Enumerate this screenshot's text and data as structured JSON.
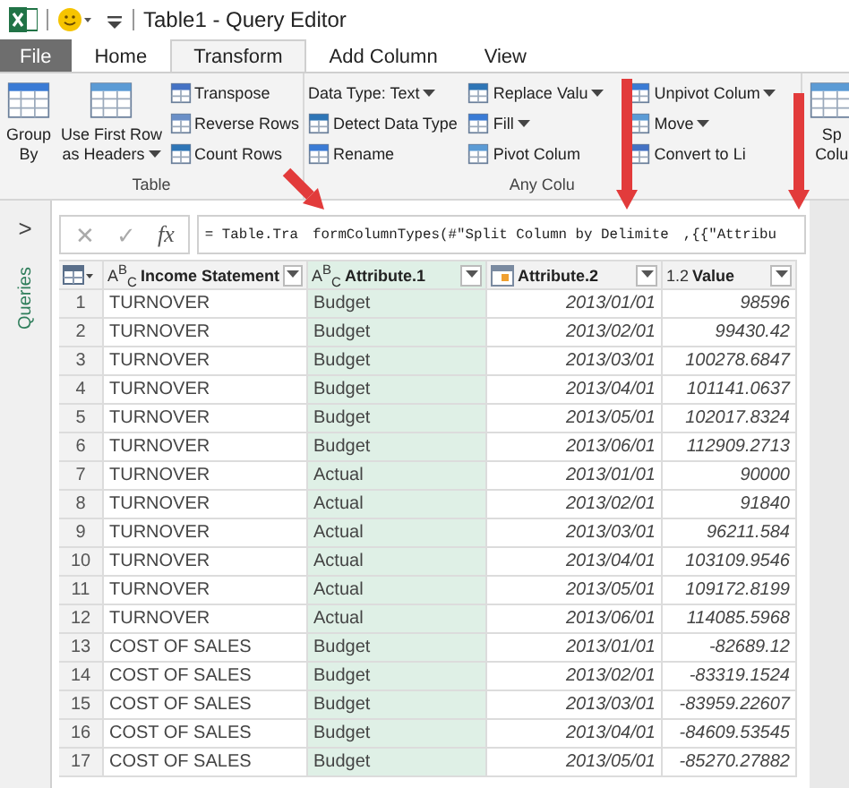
{
  "window": {
    "title": "Table1 - Query Editor"
  },
  "tabs": [
    {
      "label": "File",
      "kind": "file",
      "selected": false
    },
    {
      "label": "Home",
      "kind": "tab",
      "selected": false
    },
    {
      "label": "Transform",
      "kind": "tab",
      "selected": true
    },
    {
      "label": "Add Column",
      "kind": "tab",
      "selected": false
    },
    {
      "label": "View",
      "kind": "tab",
      "selected": false
    }
  ],
  "ribbon": {
    "groups": [
      {
        "label": "Table",
        "columns": [
          [
            {
              "kind": "large",
              "lines": [
                "Group",
                "By"
              ],
              "dropdown": false
            }
          ],
          [
            {
              "kind": "large",
              "lines": [
                "Use First Row",
                "as Headers"
              ],
              "dropdown": true
            }
          ],
          [
            {
              "kind": "small",
              "label": "Transpose",
              "dropdown": false
            },
            {
              "kind": "small",
              "label": "Reverse Rows",
              "dropdown": false
            },
            {
              "kind": "small",
              "label": "Count Rows",
              "dropdown": false
            }
          ]
        ]
      },
      {
        "label": "Any Colu",
        "columns": [
          [
            {
              "kind": "text",
              "label": "Data Type: Text",
              "dropdown": true
            },
            {
              "kind": "small",
              "label": "Detect Data Type",
              "dropdown": false
            },
            {
              "kind": "small",
              "label": "Rename",
              "dropdown": false
            }
          ],
          [
            {
              "kind": "small",
              "label": "Replace Valu",
              "dropdown": true
            },
            {
              "kind": "small",
              "label": "Fill",
              "dropdown": true
            },
            {
              "kind": "small",
              "label": "Pivot Colum",
              "dropdown": false
            }
          ],
          [
            {
              "kind": "small",
              "label": "Unpivot Colum",
              "dropdown": true
            },
            {
              "kind": "small",
              "label": "Move",
              "dropdown": true
            },
            {
              "kind": "small",
              "label": "Convert to Li",
              "dropdown": false
            }
          ]
        ]
      },
      {
        "columns": [
          [
            {
              "kind": "large",
              "lines": [
                "Sp",
                "Colu"
              ],
              "dropdown": false
            }
          ]
        ]
      }
    ]
  },
  "sidebar": {
    "expand": ">",
    "label": "Queries"
  },
  "formula_bar": {
    "cancel": "✕",
    "commit": "✓",
    "fx": "fx",
    "segments": [
      "= Table.Tra",
      "formColumnTypes(#\"Split Column by Delimite",
      ",{{\"Attribu"
    ]
  },
  "table": {
    "columns": [
      {
        "label": "Income Statement",
        "kind": "text",
        "type_label": "A$^{B}$$_{C}$",
        "selected": false
      },
      {
        "label": "Attribute.1",
        "kind": "text",
        "type_label": "A$^{B}$$_{C}$",
        "selected": true
      },
      {
        "label": "Attribute.2",
        "kind": "date",
        "selected": false
      },
      {
        "label": "Value",
        "kind": "number",
        "type_label": "1.2",
        "selected": false
      }
    ],
    "rows": [
      {
        "number": "1",
        "cells": [
          "TURNOVER",
          "Budget",
          "2013/01/01",
          "98596"
        ]
      },
      {
        "number": "2",
        "cells": [
          "TURNOVER",
          "Budget",
          "2013/02/01",
          "99430.42"
        ]
      },
      {
        "number": "3",
        "cells": [
          "TURNOVER",
          "Budget",
          "2013/03/01",
          "100278.6847"
        ]
      },
      {
        "number": "4",
        "cells": [
          "TURNOVER",
          "Budget",
          "2013/04/01",
          "101141.0637"
        ]
      },
      {
        "number": "5",
        "cells": [
          "TURNOVER",
          "Budget",
          "2013/05/01",
          "102017.8324"
        ]
      },
      {
        "number": "6",
        "cells": [
          "TURNOVER",
          "Budget",
          "2013/06/01",
          "112909.2713"
        ]
      },
      {
        "number": "7",
        "cells": [
          "TURNOVER",
          "Actual",
          "2013/01/01",
          "90000"
        ]
      },
      {
        "number": "8",
        "cells": [
          "TURNOVER",
          "Actual",
          "2013/02/01",
          "91840"
        ]
      },
      {
        "number": "9",
        "cells": [
          "TURNOVER",
          "Actual",
          "2013/03/01",
          "96211.584"
        ]
      },
      {
        "number": "10",
        "cells": [
          "TURNOVER",
          "Actual",
          "2013/04/01",
          "103109.9546"
        ]
      },
      {
        "number": "11",
        "cells": [
          "TURNOVER",
          "Actual",
          "2013/05/01",
          "109172.8199"
        ]
      },
      {
        "number": "12",
        "cells": [
          "TURNOVER",
          "Actual",
          "2013/06/01",
          "114085.5968"
        ]
      },
      {
        "number": "13",
        "cells": [
          "COST OF SALES",
          "Budget",
          "2013/01/01",
          "-82689.12"
        ]
      },
      {
        "number": "14",
        "cells": [
          "COST OF SALES",
          "Budget",
          "2013/02/01",
          "-83319.1524"
        ]
      },
      {
        "number": "15",
        "cells": [
          "COST OF SALES",
          "Budget",
          "2013/03/01",
          "-83959.22607"
        ]
      },
      {
        "number": "16",
        "cells": [
          "COST OF SALES",
          "Budget",
          "2013/04/01",
          "-84609.53545"
        ]
      },
      {
        "number": "17",
        "cells": [
          "COST OF SALES",
          "Budget",
          "2013/05/01",
          "-85270.27882"
        ]
      }
    ]
  }
}
